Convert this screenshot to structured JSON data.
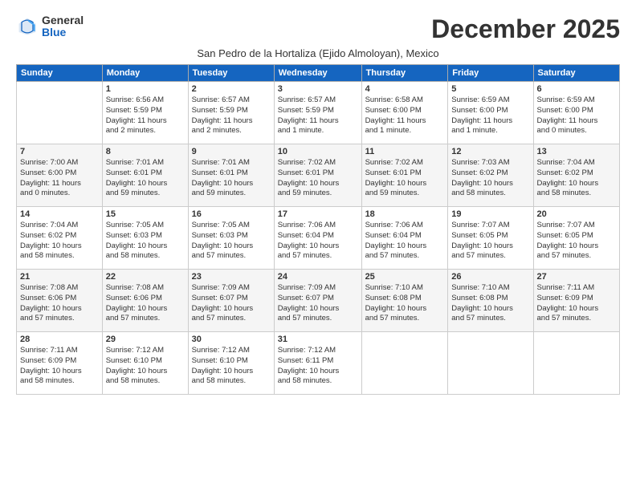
{
  "logo": {
    "general": "General",
    "blue": "Blue"
  },
  "title": "December 2025",
  "subtitle": "San Pedro de la Hortaliza (Ejido Almoloyan), Mexico",
  "days_header": [
    "Sunday",
    "Monday",
    "Tuesday",
    "Wednesday",
    "Thursday",
    "Friday",
    "Saturday"
  ],
  "weeks": [
    [
      {
        "day": "",
        "info": ""
      },
      {
        "day": "1",
        "info": "Sunrise: 6:56 AM\nSunset: 5:59 PM\nDaylight: 11 hours\nand 2 minutes."
      },
      {
        "day": "2",
        "info": "Sunrise: 6:57 AM\nSunset: 5:59 PM\nDaylight: 11 hours\nand 2 minutes."
      },
      {
        "day": "3",
        "info": "Sunrise: 6:57 AM\nSunset: 5:59 PM\nDaylight: 11 hours\nand 1 minute."
      },
      {
        "day": "4",
        "info": "Sunrise: 6:58 AM\nSunset: 6:00 PM\nDaylight: 11 hours\nand 1 minute."
      },
      {
        "day": "5",
        "info": "Sunrise: 6:59 AM\nSunset: 6:00 PM\nDaylight: 11 hours\nand 1 minute."
      },
      {
        "day": "6",
        "info": "Sunrise: 6:59 AM\nSunset: 6:00 PM\nDaylight: 11 hours\nand 0 minutes."
      }
    ],
    [
      {
        "day": "7",
        "info": "Sunrise: 7:00 AM\nSunset: 6:00 PM\nDaylight: 11 hours\nand 0 minutes."
      },
      {
        "day": "8",
        "info": "Sunrise: 7:01 AM\nSunset: 6:01 PM\nDaylight: 10 hours\nand 59 minutes."
      },
      {
        "day": "9",
        "info": "Sunrise: 7:01 AM\nSunset: 6:01 PM\nDaylight: 10 hours\nand 59 minutes."
      },
      {
        "day": "10",
        "info": "Sunrise: 7:02 AM\nSunset: 6:01 PM\nDaylight: 10 hours\nand 59 minutes."
      },
      {
        "day": "11",
        "info": "Sunrise: 7:02 AM\nSunset: 6:01 PM\nDaylight: 10 hours\nand 59 minutes."
      },
      {
        "day": "12",
        "info": "Sunrise: 7:03 AM\nSunset: 6:02 PM\nDaylight: 10 hours\nand 58 minutes."
      },
      {
        "day": "13",
        "info": "Sunrise: 7:04 AM\nSunset: 6:02 PM\nDaylight: 10 hours\nand 58 minutes."
      }
    ],
    [
      {
        "day": "14",
        "info": "Sunrise: 7:04 AM\nSunset: 6:02 PM\nDaylight: 10 hours\nand 58 minutes."
      },
      {
        "day": "15",
        "info": "Sunrise: 7:05 AM\nSunset: 6:03 PM\nDaylight: 10 hours\nand 58 minutes."
      },
      {
        "day": "16",
        "info": "Sunrise: 7:05 AM\nSunset: 6:03 PM\nDaylight: 10 hours\nand 57 minutes."
      },
      {
        "day": "17",
        "info": "Sunrise: 7:06 AM\nSunset: 6:04 PM\nDaylight: 10 hours\nand 57 minutes."
      },
      {
        "day": "18",
        "info": "Sunrise: 7:06 AM\nSunset: 6:04 PM\nDaylight: 10 hours\nand 57 minutes."
      },
      {
        "day": "19",
        "info": "Sunrise: 7:07 AM\nSunset: 6:05 PM\nDaylight: 10 hours\nand 57 minutes."
      },
      {
        "day": "20",
        "info": "Sunrise: 7:07 AM\nSunset: 6:05 PM\nDaylight: 10 hours\nand 57 minutes."
      }
    ],
    [
      {
        "day": "21",
        "info": "Sunrise: 7:08 AM\nSunset: 6:06 PM\nDaylight: 10 hours\nand 57 minutes."
      },
      {
        "day": "22",
        "info": "Sunrise: 7:08 AM\nSunset: 6:06 PM\nDaylight: 10 hours\nand 57 minutes."
      },
      {
        "day": "23",
        "info": "Sunrise: 7:09 AM\nSunset: 6:07 PM\nDaylight: 10 hours\nand 57 minutes."
      },
      {
        "day": "24",
        "info": "Sunrise: 7:09 AM\nSunset: 6:07 PM\nDaylight: 10 hours\nand 57 minutes."
      },
      {
        "day": "25",
        "info": "Sunrise: 7:10 AM\nSunset: 6:08 PM\nDaylight: 10 hours\nand 57 minutes."
      },
      {
        "day": "26",
        "info": "Sunrise: 7:10 AM\nSunset: 6:08 PM\nDaylight: 10 hours\nand 57 minutes."
      },
      {
        "day": "27",
        "info": "Sunrise: 7:11 AM\nSunset: 6:09 PM\nDaylight: 10 hours\nand 57 minutes."
      }
    ],
    [
      {
        "day": "28",
        "info": "Sunrise: 7:11 AM\nSunset: 6:09 PM\nDaylight: 10 hours\nand 58 minutes."
      },
      {
        "day": "29",
        "info": "Sunrise: 7:12 AM\nSunset: 6:10 PM\nDaylight: 10 hours\nand 58 minutes."
      },
      {
        "day": "30",
        "info": "Sunrise: 7:12 AM\nSunset: 6:10 PM\nDaylight: 10 hours\nand 58 minutes."
      },
      {
        "day": "31",
        "info": "Sunrise: 7:12 AM\nSunset: 6:11 PM\nDaylight: 10 hours\nand 58 minutes."
      },
      {
        "day": "",
        "info": ""
      },
      {
        "day": "",
        "info": ""
      },
      {
        "day": "",
        "info": ""
      }
    ]
  ]
}
